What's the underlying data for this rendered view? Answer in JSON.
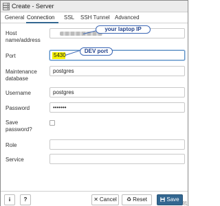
{
  "window": {
    "title": "Create - Server"
  },
  "tabs": [
    {
      "label": "General"
    },
    {
      "label": "Connection"
    },
    {
      "label": "SSL"
    },
    {
      "label": "SSH Tunnel"
    },
    {
      "label": "Advanced"
    }
  ],
  "active_tab": "Connection",
  "form": {
    "host": {
      "label_line1": "Host",
      "label_line2": "name/address"
    },
    "port": {
      "label": "Port",
      "value": "5430"
    },
    "maintenance_db": {
      "label_line1": "Maintenance",
      "label_line2": "database",
      "value": "postgres"
    },
    "username": {
      "label": "Username",
      "value": "postgres"
    },
    "password": {
      "label": "Password",
      "value": "•••••••"
    },
    "save_password": {
      "label_line1": "Save",
      "label_line2": "password?",
      "checked": false
    },
    "role": {
      "label": "Role",
      "value": ""
    },
    "service": {
      "label": "Service",
      "value": ""
    }
  },
  "annotations": {
    "host_callout": "your laptop IP",
    "port_callout": "DEV port",
    "color": "#3a66b5"
  },
  "footer": {
    "info_label": "i",
    "help_label": "?",
    "cancel_label": "Cancel",
    "reset_label": "Reset",
    "save_label": "Save"
  },
  "colors": {
    "primary": "#326690",
    "highlight": "#f6f200",
    "focus_border": "#5b8ec2"
  },
  "icons": {
    "title": "server-icon",
    "cancel": "close-icon",
    "reset": "recycle-icon",
    "save": "floppy-disk-icon"
  }
}
